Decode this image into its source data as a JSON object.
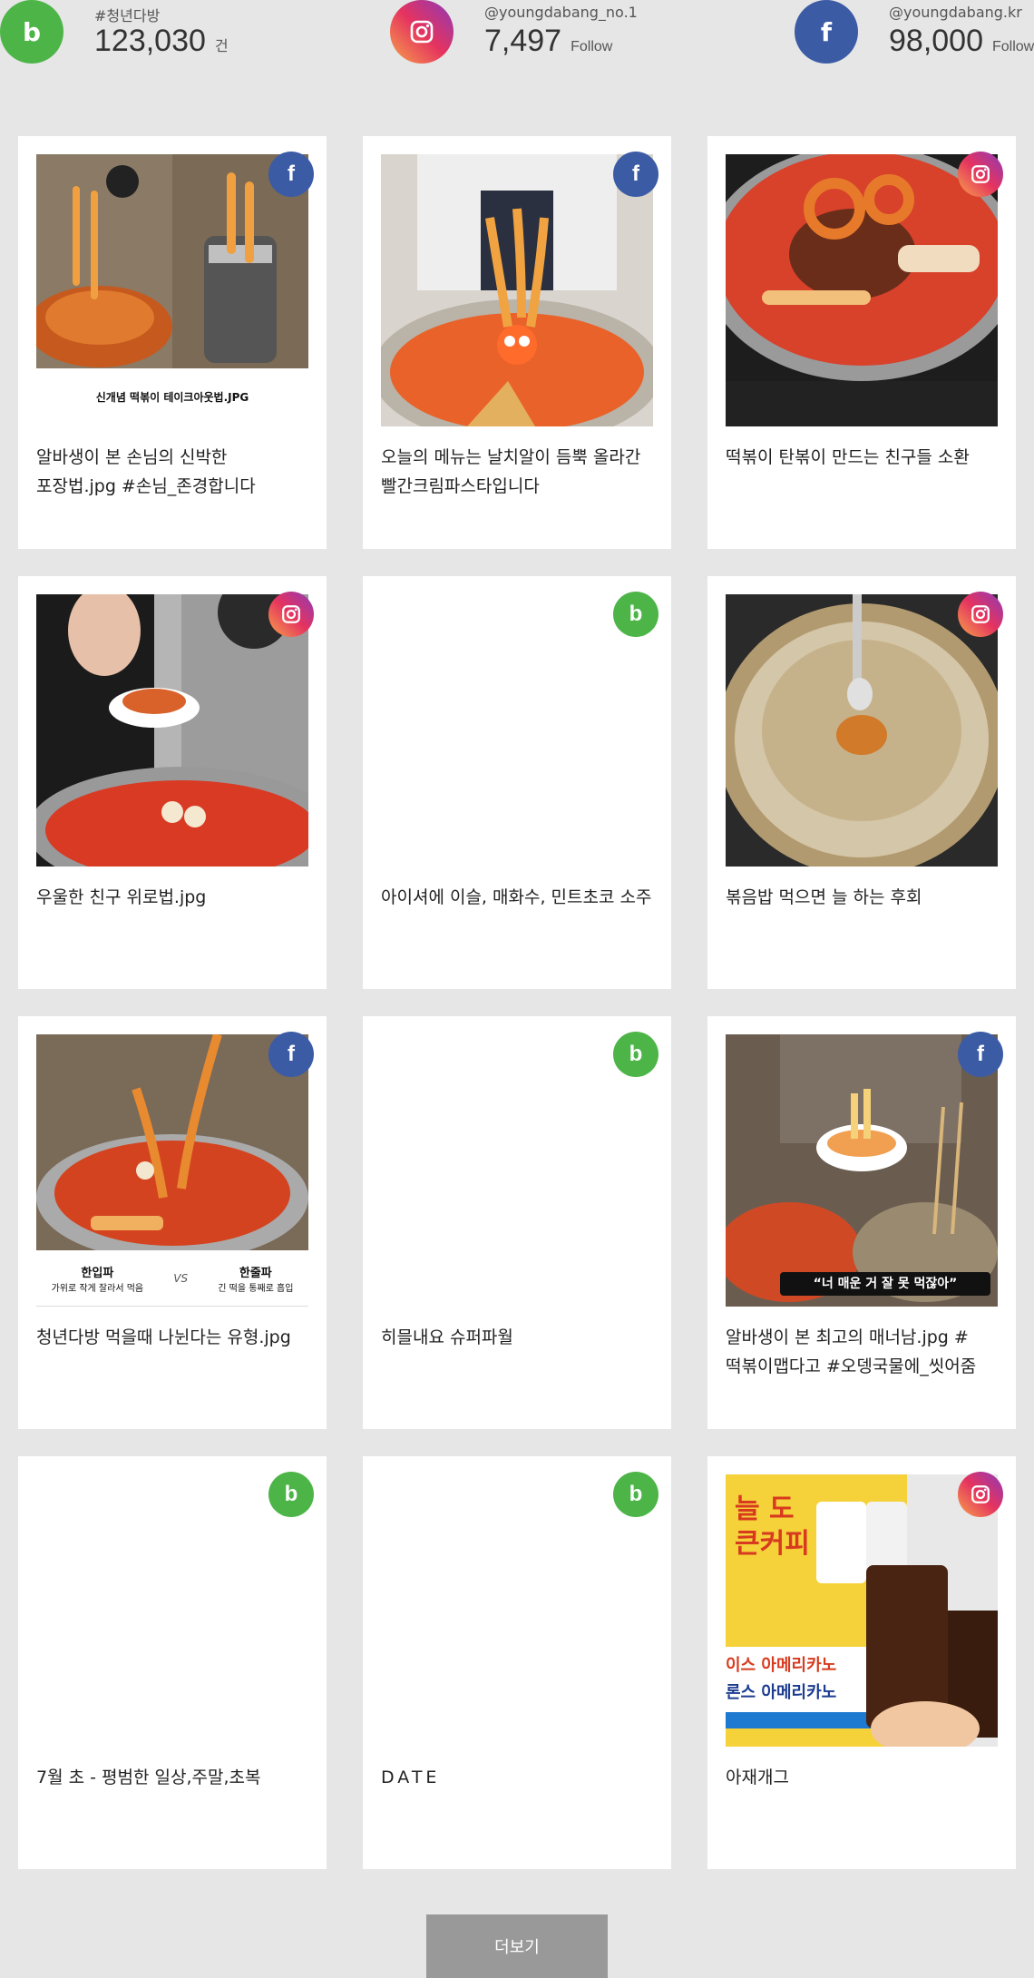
{
  "stats": [
    {
      "platform": "blog",
      "icon": "blog-icon",
      "icon_glyph": "b",
      "handle": "#청년다방",
      "count": "123,030",
      "unit": "건"
    },
    {
      "platform": "instagram",
      "icon": "instagram-icon",
      "icon_glyph": "◎",
      "handle": "@youngdabang_no.1",
      "count": "7,497",
      "unit": "Follow"
    },
    {
      "platform": "facebook",
      "icon": "facebook-icon",
      "icon_glyph": "f",
      "handle": "@youngdabang.kr",
      "count": "98,000",
      "unit": "Follow"
    }
  ],
  "posts": [
    {
      "source": "facebook",
      "title": "알바생이 본 손님의 신박한 포장법.jpg #손님_존경합니다",
      "caption": "신개념 떡볶이 테이크아웃법.JPG",
      "image": "takeout"
    },
    {
      "source": "facebook",
      "title": "오늘의 메뉴는 날치알이 듬뿍 올라간 빨간크림파스타입니다",
      "caption": "",
      "image": "pasta"
    },
    {
      "source": "instagram",
      "title": "떡볶이 탄볶이 만드는 친구들 소환",
      "caption": "",
      "image": "burnt"
    },
    {
      "source": "instagram",
      "title": "우울한 친구 위로법.jpg",
      "caption": "",
      "image": "comfort"
    },
    {
      "source": "blog",
      "title": "아이셔에 이슬, 매화수, 민트초코 소주",
      "caption": "",
      "image": "none"
    },
    {
      "source": "instagram",
      "title": "볶음밥 먹으면 늘 하는 후회",
      "caption": "",
      "image": "friedrice"
    },
    {
      "source": "facebook",
      "title": "청년다방 먹을때 나뉜다는 유형.jpg",
      "caption": "한입파 가위로 작게 잘라서 먹음 VS 한줄파 긴 떡을 통째로 흡입",
      "image": "types"
    },
    {
      "source": "blog",
      "title": "히믈내요 슈퍼파월",
      "caption": "",
      "image": "none"
    },
    {
      "source": "facebook",
      "title": "알바생이 본 최고의 매너남.jpg #떡볶이맵다고 #오뎅국물에_씻어줌",
      "caption": "“너 매운 거 잘 못 먹잖아”",
      "image": "manner"
    },
    {
      "source": "blog",
      "title": "7월 초 - 평범한 일상,주말,초복",
      "caption": "",
      "image": "none"
    },
    {
      "source": "blog",
      "title": "DATE",
      "caption": "",
      "image": "none"
    },
    {
      "source": "instagram",
      "title": "아재개그",
      "caption": "",
      "image": "coffee"
    }
  ],
  "icons": {
    "blog": "b",
    "instagram": "◎",
    "facebook": "f"
  },
  "types_caption": {
    "left_title": "한입파",
    "left_sub": "가위로 작게 잘라서 먹음",
    "vs": "VS",
    "right_title": "한줄파",
    "right_sub": "긴 떡을 통째로 흡입"
  },
  "coffee_text": {
    "line1": "늘 도",
    "line2": "큰커피",
    "line3": "이스 아메리카노",
    "line4": "론스 아메리카노"
  },
  "more_button": "더보기",
  "colors": {
    "blog": "#4db548",
    "facebook": "#3b5ba5",
    "instagram": "#e5335f",
    "background": "#e6e6e6",
    "button": "#999999"
  }
}
